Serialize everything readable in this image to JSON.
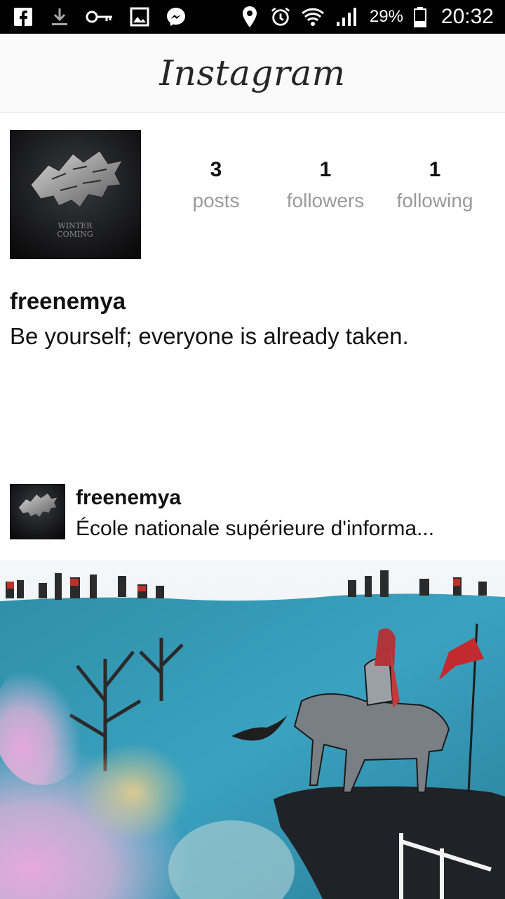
{
  "status_bar": {
    "left_icons": [
      "facebook-icon",
      "download-icon",
      "key-icon",
      "gallery-icon",
      "messenger-icon"
    ],
    "right_icons": [
      "location-icon",
      "alarm-icon",
      "wifi-icon",
      "signal-icon"
    ],
    "battery": "29%",
    "battery_level": 0.29,
    "time": "20:32"
  },
  "header": {
    "logo": "Instagram"
  },
  "profile": {
    "stats": [
      {
        "count": "3",
        "label": "posts"
      },
      {
        "count": "1",
        "label": "followers"
      },
      {
        "count": "1",
        "label": "following"
      }
    ],
    "username": "freenemya",
    "bio": "Be yourself; everyone is already taken.",
    "avatar_text": [
      "WINTER",
      "COMING"
    ]
  },
  "post": {
    "username": "freenemya",
    "location": "École nationale supérieure d'informa..."
  },
  "colors": {
    "header_bg": "#fafafa",
    "stat_label": "#9a9a9a",
    "text": "#111111"
  }
}
